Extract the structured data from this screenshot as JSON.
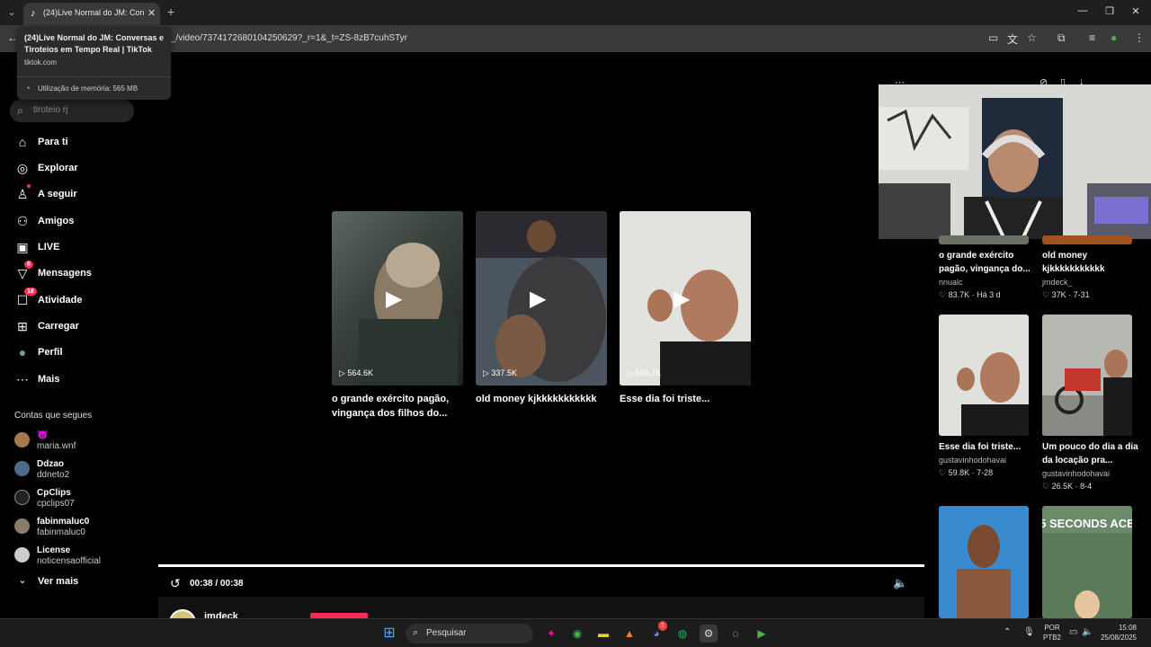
{
  "browser": {
    "tab_title": "(24)Live Normal do JM: Conver",
    "url": "_/video/7374172680104250629?_r=1&_t=ZS-8zB7cuhSTyr",
    "tooltip": {
      "title": "(24)Live Normal do JM: Conversas e Tiroteios em Tempo Real | TikTok",
      "domain": "tiktok.com",
      "memory": "Utilização de memória: 565 MB"
    }
  },
  "sidebar": {
    "search_placeholder": "tiroteio rj",
    "nav": [
      {
        "label": "Para ti",
        "icon": "home-icon"
      },
      {
        "label": "Explorar",
        "icon": "compass-icon"
      },
      {
        "label": "A seguir",
        "icon": "following-icon"
      },
      {
        "label": "Amigos",
        "icon": "friends-icon"
      },
      {
        "label": "LIVE",
        "icon": "live-icon"
      },
      {
        "label": "Mensagens",
        "icon": "messages-icon",
        "badge": "6"
      },
      {
        "label": "Atividade",
        "icon": "activity-icon",
        "badge": "18"
      },
      {
        "label": "Carregar",
        "icon": "upload-icon"
      },
      {
        "label": "Perfil",
        "icon": "profile-icon"
      },
      {
        "label": "Mais",
        "icon": "more-icon"
      }
    ],
    "following_title": "Contas que segues",
    "accounts": [
      {
        "name": "😈",
        "user": "maria.wnf"
      },
      {
        "name": "Ddzao",
        "user": "ddneto2"
      },
      {
        "name": "CpClips",
        "user": "cpclips07"
      },
      {
        "name": "fabinmaluc0",
        "user": "fabinmaluc0"
      },
      {
        "name": "License",
        "user": "noticensaofficial"
      }
    ],
    "see_more": "Ver mais"
  },
  "videos": [
    {
      "views": "564.6K",
      "title": "o grande exército pagão, vingança dos filhos do..."
    },
    {
      "views": "337.5K",
      "title": "old money kjkkkkkkkkkkk"
    },
    {
      "views": "565.7K",
      "title": "Esse dia foi triste..."
    }
  ],
  "player": {
    "time": "00:38 / 00:38",
    "author": "jmdeck",
    "progress": 1.0
  },
  "right_column": [
    {
      "title": "o grande exército pagão, vingança do...",
      "user": "nnualc",
      "likes": "83.7K",
      "date": "Há 3 d"
    },
    {
      "title": "old money kjkkkkkkkkkkk",
      "user": "jmdeck_",
      "likes": "37K",
      "date": "7-31"
    },
    {
      "title": "Esse dia foi triste...",
      "user": "gustavinhodohavai",
      "likes": "59.8K",
      "date": "7-28"
    },
    {
      "title": "Um pouco do dia a dia da locação pra...",
      "user": "gustavinhodohavai",
      "likes": "26.5K",
      "date": "8-4"
    },
    {
      "overlay": "5 SECONDS ACE"
    }
  ],
  "taskbar": {
    "search": "Pesquisar",
    "lang1": "POR",
    "lang2": "PTB2",
    "time": "15:08",
    "date": "25/08/2025",
    "discord_badge": "1"
  },
  "colors": {
    "accent": "#fe2c55",
    "background": "#000000"
  }
}
